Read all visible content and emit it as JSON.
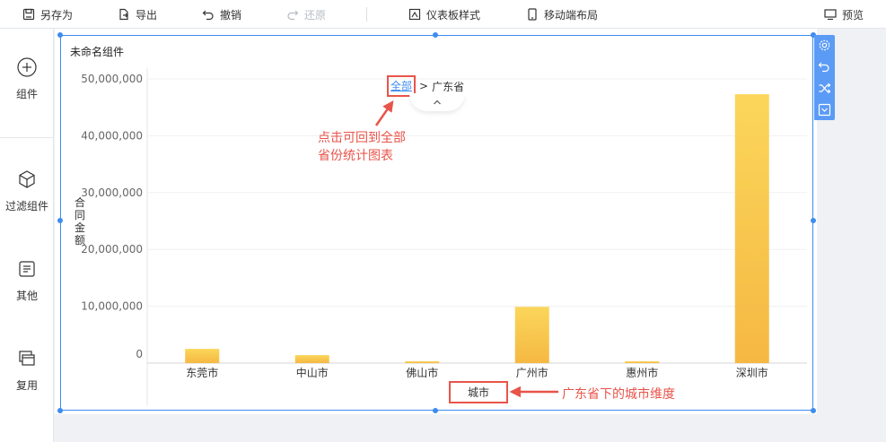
{
  "toolbar": {
    "save_as": "另存为",
    "export": "导出",
    "undo": "撤销",
    "redo": "还原",
    "dashboard_style": "仪表板样式",
    "mobile_layout": "移动端布局",
    "preview": "预览"
  },
  "sidebar": {
    "items": [
      {
        "label": "组件",
        "icon": "plus-circle-icon"
      },
      {
        "label": "过滤组件",
        "icon": "cube-icon"
      },
      {
        "label": "其他",
        "icon": "document-icon"
      },
      {
        "label": "复用",
        "icon": "layers-icon"
      }
    ]
  },
  "widget": {
    "title": "未命名组件",
    "breadcrumb": {
      "all": "全部",
      "separator": ">",
      "current": "广东省"
    }
  },
  "annotations": {
    "drill_up_line1": "点击可回到全部",
    "drill_up_line2": "省份统计图表",
    "dimension_note": "广东省下的城市维度"
  },
  "colors": {
    "accent": "#3d8cf0",
    "annotation": "#e8544a",
    "bar_top": "#fbd65a",
    "bar_bottom": "#f5b843"
  },
  "chart_data": {
    "type": "bar",
    "categories": [
      "东莞市",
      "中山市",
      "佛山市",
      "广州市",
      "惠州市",
      "深圳市"
    ],
    "values": [
      2500000,
      1400000,
      200000,
      9900000,
      200000,
      47300000
    ],
    "ylabel": "合同金额",
    "xlabel": "城市",
    "ylim": [
      0,
      50000000
    ],
    "yticks": [
      0,
      10000000,
      20000000,
      30000000,
      40000000,
      50000000
    ],
    "ytick_labels": [
      "0",
      "10,000,000",
      "20,000,000",
      "30,000,000",
      "40,000,000",
      "50,000,000"
    ],
    "grid": true
  }
}
